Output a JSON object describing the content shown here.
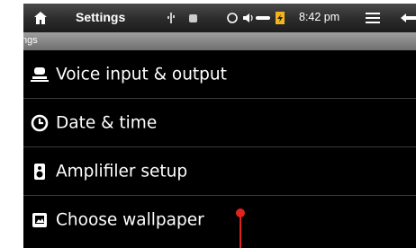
{
  "statusbar": {
    "title": "Settings",
    "time": "8:42 pm"
  },
  "titlebar": {
    "label": "Settings"
  },
  "items": [
    {
      "label": "Voice input & output",
      "icon": "voice-icon"
    },
    {
      "label": "Date & time",
      "icon": "clock-icon"
    },
    {
      "label": "Amplifiler setup",
      "icon": "speaker-icon"
    },
    {
      "label": "Choose wallpaper",
      "icon": "wallpaper-icon"
    }
  ],
  "colors": {
    "background": "#000000",
    "pointer": "#e0231c"
  }
}
